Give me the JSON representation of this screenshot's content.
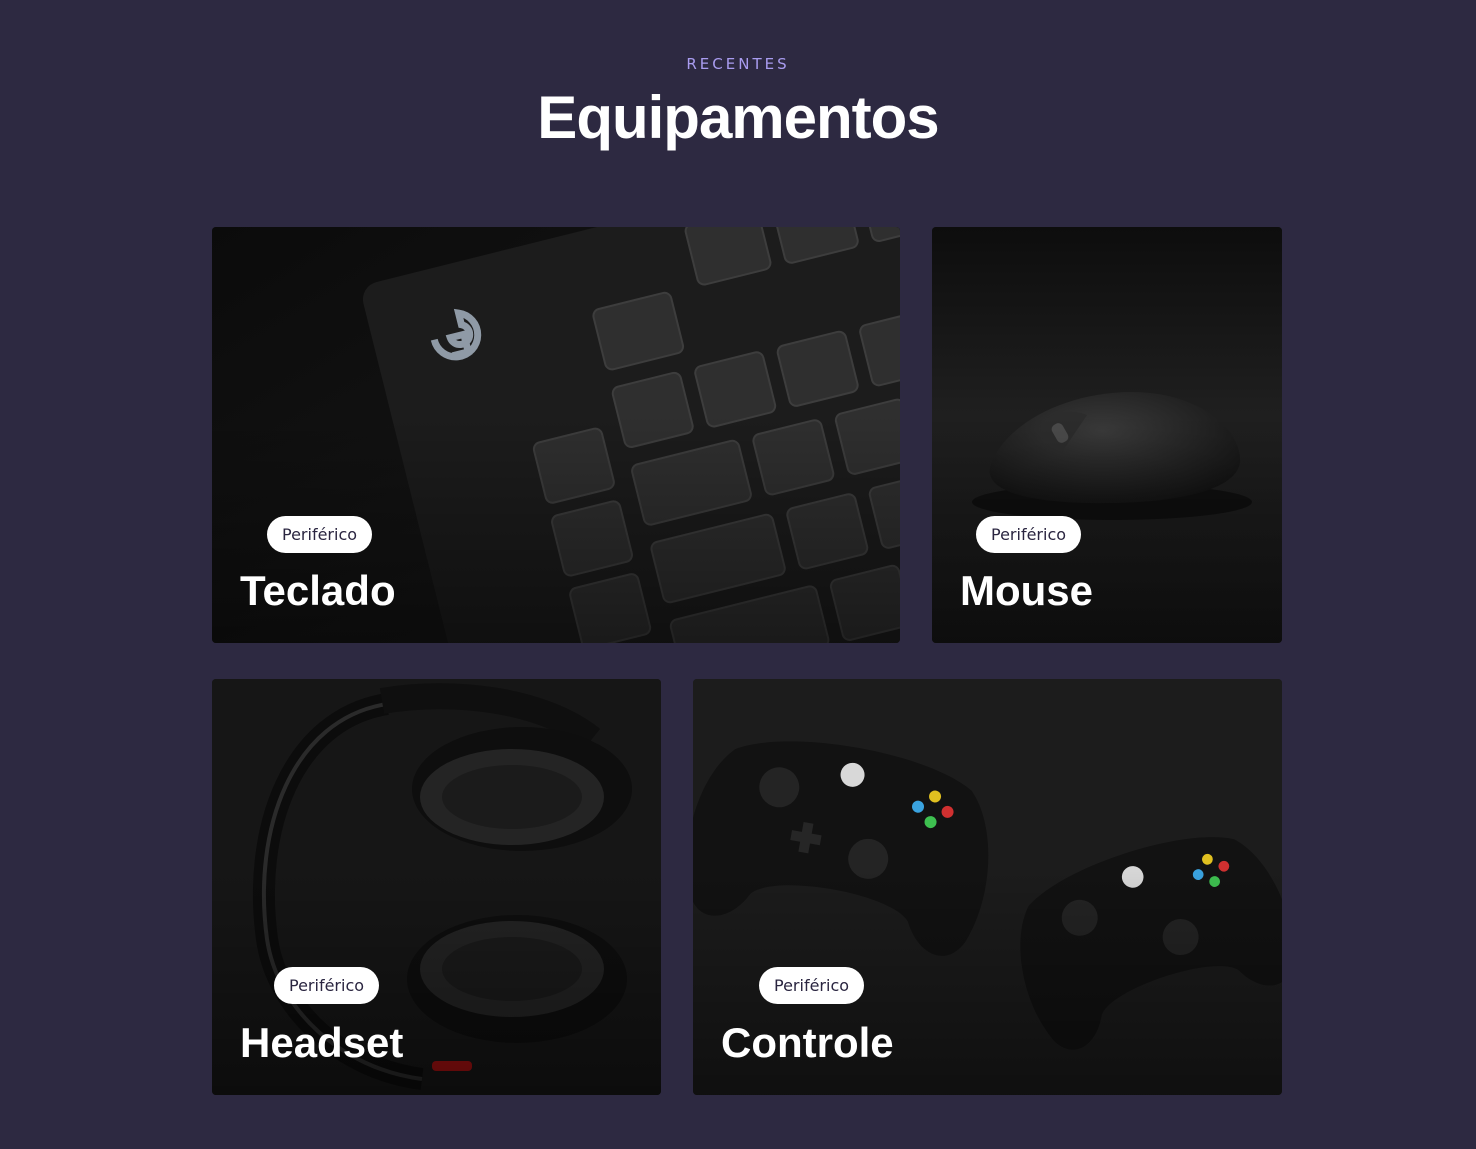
{
  "section": {
    "eyebrow": "RECENTES",
    "title": "Equipamentos"
  },
  "cards": [
    {
      "title": "Teclado",
      "tag": "Periférico",
      "image": "keyboard-photo"
    },
    {
      "title": "Mouse",
      "tag": "Periférico",
      "image": "mouse-photo"
    },
    {
      "title": "Headset",
      "tag": "Periférico",
      "image": "headset-photo"
    },
    {
      "title": "Controle",
      "tag": "Periférico",
      "image": "gamepad-photo"
    }
  ],
  "colors": {
    "background": "#2d2941",
    "eyebrow": "#a99cf0",
    "tag_background": "#ffffff",
    "tag_text": "#2a2540",
    "title": "#ffffff"
  }
}
